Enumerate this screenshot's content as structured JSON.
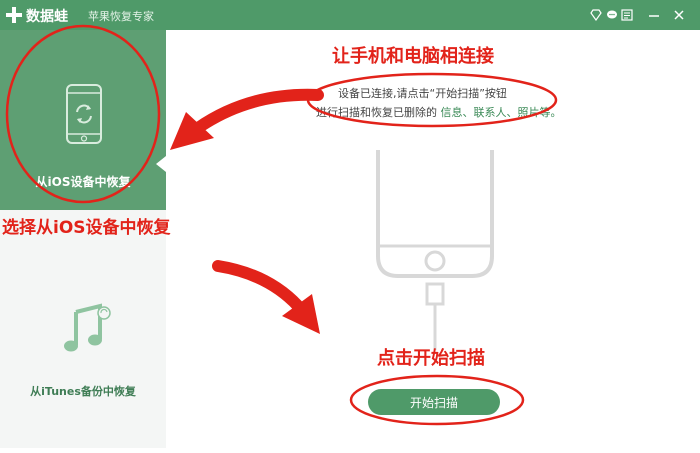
{
  "app": {
    "name": "数据蛙",
    "subtitle": "苹果恢复专家"
  },
  "sidebar": {
    "items": [
      {
        "label": "从iOS设备中恢复",
        "icon": "phone-refresh-icon",
        "selected": true
      },
      {
        "label": "从iTunes备份中恢复",
        "icon": "music-note-icon",
        "selected": false
      }
    ]
  },
  "main": {
    "status": "设备已连接,请点击“开始扫描”按钮",
    "hint_prefix": "进行扫描和恢复已删除的",
    "hint_items": "信息、联系人、照片等。",
    "scan_button": "开始扫描"
  },
  "annotations": {
    "connect": "让手机和电脑相连接",
    "choose": "选择从iOS设备中恢复",
    "click_scan": "点击开始扫描"
  },
  "colors": {
    "accent": "#4f9a69",
    "annotation": "#e2231a"
  }
}
